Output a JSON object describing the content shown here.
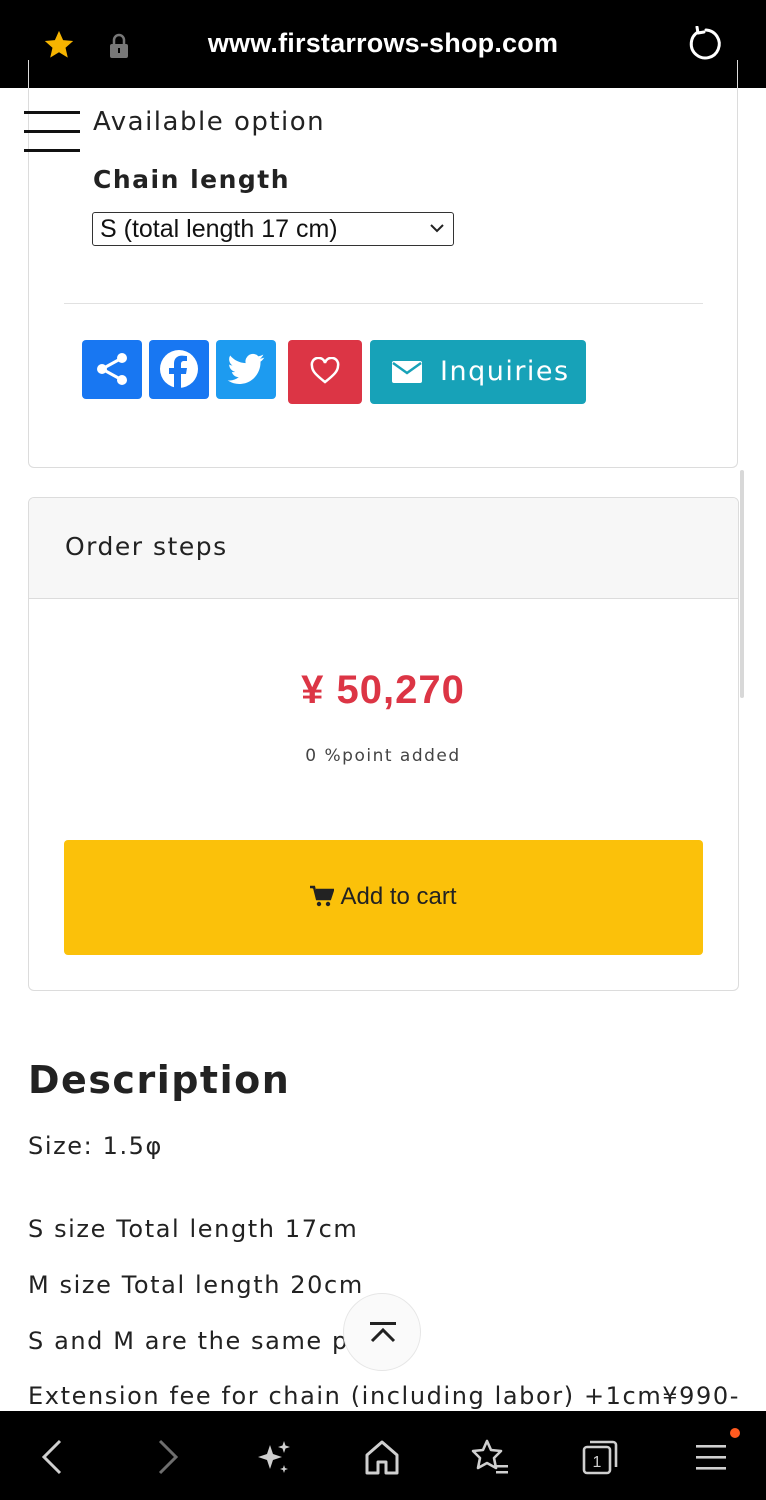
{
  "browser": {
    "url": "www.firstarrows-shop.com"
  },
  "product": {
    "available_option_label": "Available option",
    "chain_length_label": "Chain length",
    "chain_length_selected": "S (total length 17 cm)",
    "inquiries_label": "Inquiries"
  },
  "order": {
    "title": "Order steps",
    "price": "¥ 50,270",
    "points": "0 %point added",
    "add_to_cart_label": "Add to cart"
  },
  "description": {
    "title": "Description",
    "lines": [
      "Size: 1.5φ",
      "S size Total length 17cm",
      "M size Total length 20cm",
      "S and M are the same pr",
      "Extension fee for chain (including labor) +1cm¥990-"
    ]
  },
  "colors": {
    "price_red": "#dc3545",
    "cart_yellow": "#fbc10a",
    "inquiries_teal": "#17a2b8",
    "facebook_blue": "#1877f2",
    "twitter_blue": "#1d9bf0"
  },
  "icons": {
    "top": [
      "star-icon",
      "lock-icon",
      "reload-icon"
    ],
    "share": [
      "share-icon",
      "facebook-icon",
      "twitter-icon",
      "heart-icon",
      "mail-icon"
    ],
    "bottom": [
      "back-icon",
      "forward-icon",
      "sparkle-icon",
      "home-icon",
      "bookmarks-icon",
      "tabs-icon",
      "menu-icon"
    ]
  },
  "tabs_count": "1"
}
